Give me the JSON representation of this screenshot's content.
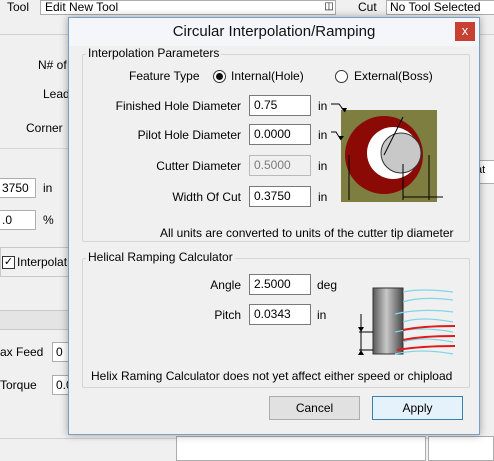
{
  "background": {
    "tool_label": "Tool",
    "tool_combo_value": "Edit New Tool",
    "cut_label": "Cut",
    "cut_value": "No Tool Selected",
    "labels": [
      "N# of",
      "Lead",
      "Corner"
    ],
    "input_1_value": "3750",
    "input_1_unit": "in",
    "input_2_value": ".0",
    "input_2_unit": "%",
    "checkbox_label": "Interpolat",
    "max_feed_label": "ax Feed",
    "max_feed_value": "0",
    "torque_label": "Torque",
    "torque_value": "0.0",
    "right_strip_text": "at"
  },
  "dialog": {
    "title": "Circular Interpolation/Ramping",
    "close_label": "x",
    "interp": {
      "group_title": "Interpolation Parameters",
      "feature_type_label": "Feature Type",
      "feature_options": [
        {
          "label": "Internal(Hole)",
          "selected": true
        },
        {
          "label": "External(Boss)",
          "selected": false
        }
      ],
      "fields": [
        {
          "label": "Finished Hole Diameter",
          "value": "0.75",
          "unit": "in",
          "disabled": false
        },
        {
          "label": "Pilot Hole Diameter",
          "value": "0.0000",
          "unit": "in",
          "disabled": false
        },
        {
          "label": "Cutter Diameter",
          "value": "0.5000",
          "unit": "in",
          "disabled": true
        },
        {
          "label": "Width Of Cut",
          "value": "0.3750",
          "unit": "in",
          "disabled": false
        }
      ],
      "note": "All units are converted to units of the cutter tip diameter",
      "colors": {
        "olive": "#7d7e3f",
        "ring": "#8b0a06",
        "cutter": "#c8c8c8"
      }
    },
    "helical": {
      "group_title": "Helical Ramping Calculator",
      "fields": [
        {
          "label": "Angle",
          "value": "2.5000",
          "unit": "deg"
        },
        {
          "label": "Pitch",
          "value": "0.0343",
          "unit": "in"
        }
      ],
      "note": "Helix Raming Calculator does not yet affect either speed or chipload",
      "colors": {
        "helix": "#7fd6e6",
        "path": "#e01a1a"
      }
    },
    "buttons": {
      "cancel": "Cancel",
      "apply": "Apply"
    }
  }
}
